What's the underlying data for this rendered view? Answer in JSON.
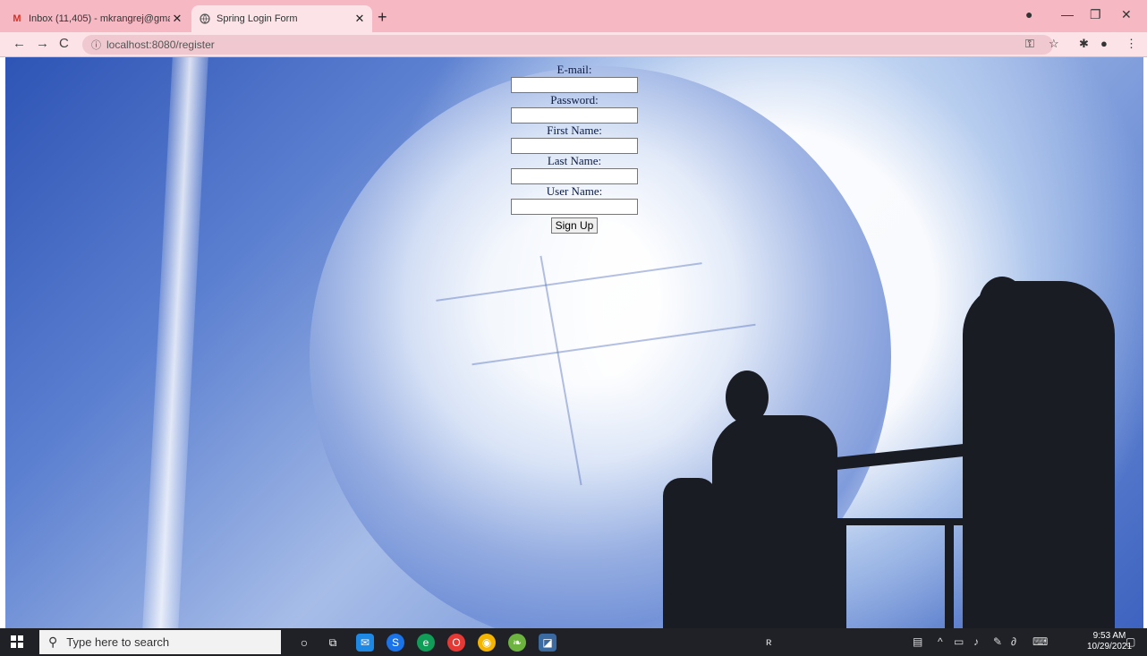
{
  "tabs": [
    {
      "title": "Inbox (11,405) - mkrangrej@gma",
      "favicon": "gmail-icon"
    },
    {
      "title": "Spring Login Form",
      "favicon": "globe-icon"
    }
  ],
  "address": {
    "url": "localhost:8080/register"
  },
  "form": {
    "email_label": "E-mail:",
    "password_label": "Password:",
    "first_name_label": "First Name:",
    "last_name_label": "Last Name:",
    "user_name_label": "User Name:",
    "submit_label": "Sign Up"
  },
  "taskbar": {
    "search_placeholder": "Type here to search",
    "time": "9:53 AM",
    "date": "10/29/2021"
  }
}
